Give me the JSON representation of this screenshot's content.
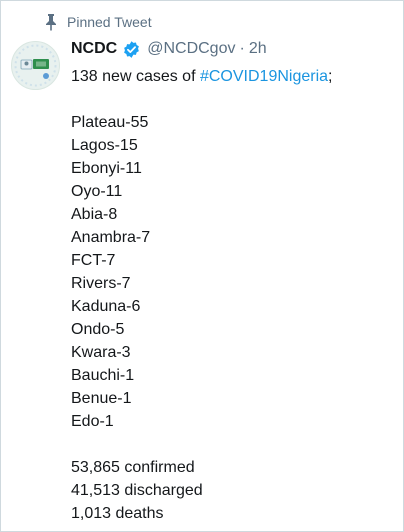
{
  "pinned_label": "Pinned Tweet",
  "author": {
    "name": "NCDC",
    "handle": "@NCDCgov",
    "separator": "·",
    "time": "2h"
  },
  "tweet": {
    "intro": "138 new cases of ",
    "hashtag": "#COVID19Nigeria",
    "intro_end": ";",
    "states": [
      "Plateau-55",
      "Lagos-15",
      "Ebonyi-11",
      "Oyo-11",
      "Abia-8",
      "Anambra-7",
      "FCT-7",
      "Rivers-7",
      "Kaduna-6",
      "Ondo-5",
      "Kwara-3",
      "Bauchi-1",
      "Benue-1",
      "Edo-1"
    ],
    "summary": [
      "53,865 confirmed",
      "41,513 discharged",
      "1,013 deaths"
    ]
  },
  "colors": {
    "link": "#1b95e0",
    "verified": "#1da1f2",
    "muted": "#5b7083"
  },
  "icons": {
    "pin": "pin-icon",
    "verified": "verified-badge-icon",
    "avatar": "ncdc-logo-avatar"
  }
}
